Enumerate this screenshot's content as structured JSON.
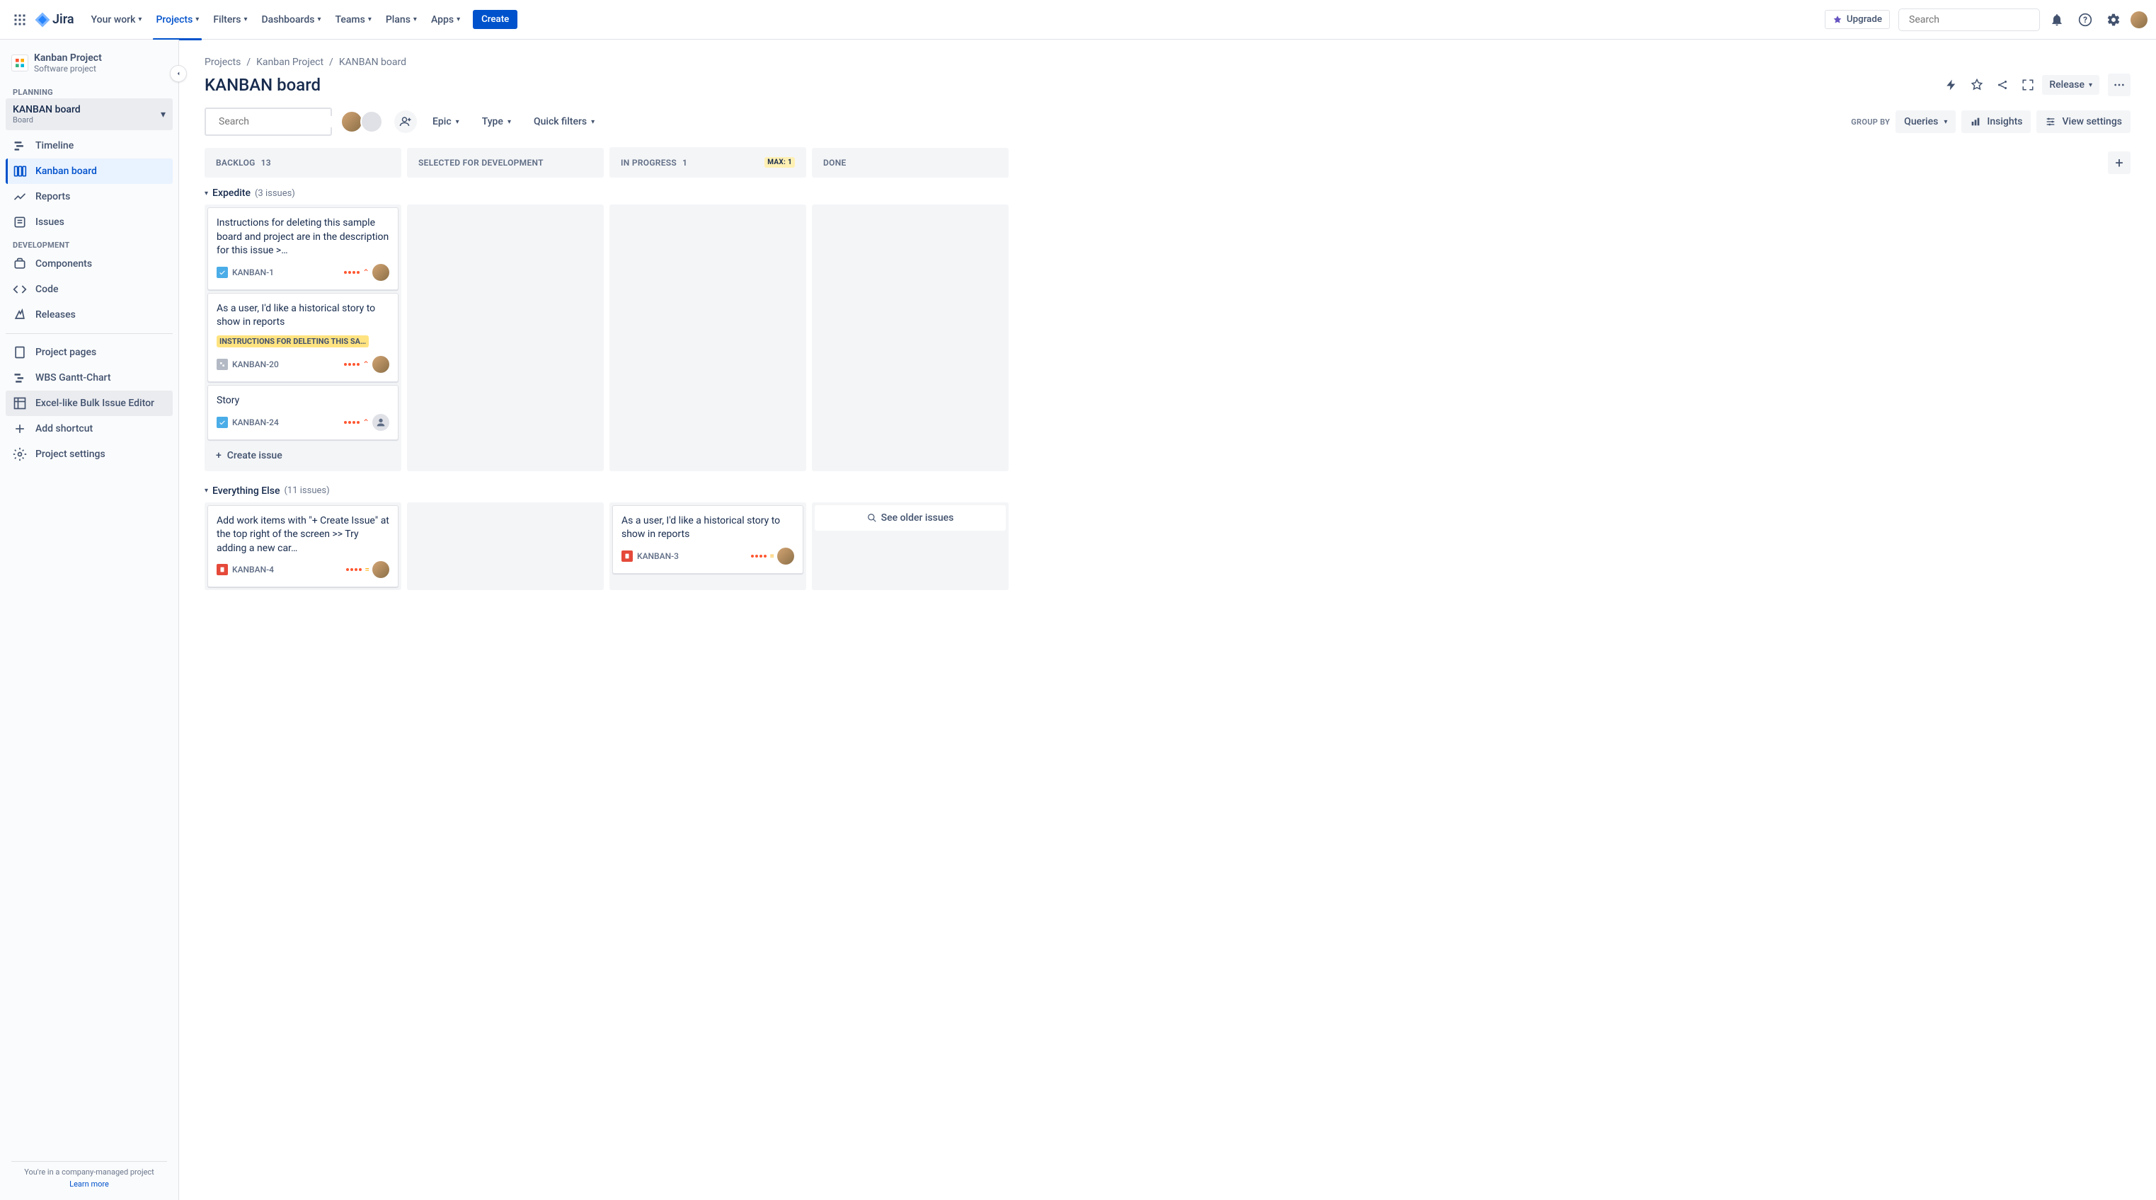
{
  "topnav": {
    "logo_text": "Jira",
    "items": [
      {
        "label": "Your work",
        "active": false
      },
      {
        "label": "Projects",
        "active": true
      },
      {
        "label": "Filters",
        "active": false
      },
      {
        "label": "Dashboards",
        "active": false
      },
      {
        "label": "Teams",
        "active": false
      },
      {
        "label": "Plans",
        "active": false
      },
      {
        "label": "Apps",
        "active": false
      }
    ],
    "create_label": "Create",
    "upgrade_label": "Upgrade",
    "search_placeholder": "Search"
  },
  "sidebar": {
    "project_name": "Kanban Project",
    "project_type": "Software project",
    "group_planning": "PLANNING",
    "board_selector": {
      "title": "KANBAN board",
      "subtitle": "Board"
    },
    "planning_items": [
      {
        "label": "Timeline",
        "selected": false
      },
      {
        "label": "Kanban board",
        "selected": true
      },
      {
        "label": "Reports",
        "selected": false
      },
      {
        "label": "Issues",
        "selected": false
      }
    ],
    "group_development": "DEVELOPMENT",
    "dev_items": [
      {
        "label": "Components"
      },
      {
        "label": "Code"
      },
      {
        "label": "Releases"
      }
    ],
    "other_items": [
      {
        "label": "Project pages"
      },
      {
        "label": "WBS Gantt-Chart"
      },
      {
        "label": "Excel-like Bulk Issue Editor"
      },
      {
        "label": "Add shortcut"
      },
      {
        "label": "Project settings"
      }
    ],
    "footer_text": "You're in a company-managed project",
    "learn_more": "Learn more"
  },
  "breadcrumbs": [
    "Projects",
    "Kanban Project",
    "KANBAN board"
  ],
  "page_title": "KANBAN board",
  "head_actions": {
    "release_label": "Release"
  },
  "controls": {
    "search_placeholder": "Search",
    "filter_epic": "Epic",
    "filter_type": "Type",
    "filter_quick": "Quick filters",
    "group_by_label": "GROUP BY",
    "queries_label": "Queries",
    "insights_label": "Insights",
    "view_settings_label": "View settings"
  },
  "columns": [
    {
      "name": "BACKLOG",
      "count": "13"
    },
    {
      "name": "SELECTED FOR DEVELOPMENT",
      "count": ""
    },
    {
      "name": "IN PROGRESS",
      "count": "1",
      "max": "MAX: 1"
    },
    {
      "name": "DONE",
      "count": ""
    }
  ],
  "swimlanes": [
    {
      "name": "Expedite",
      "issue_count": "(3 issues)",
      "lanes": [
        {
          "cards": [
            {
              "title": "Instructions for deleting this sample board and project are in the description for this issue >…",
              "type": "task",
              "key": "KANBAN-1",
              "priority": "highest",
              "assignee": "user"
            },
            {
              "title": "As a user, I'd like a historical story to show in reports",
              "epic": "INSTRUCTIONS FOR DELETING THIS SA…",
              "type": "subtask",
              "key": "KANBAN-20",
              "priority": "highest",
              "assignee": "user"
            },
            {
              "title": "Story",
              "type": "task",
              "key": "KANBAN-24",
              "priority": "highest",
              "assignee": "unassigned"
            }
          ],
          "create_label": "Create issue"
        },
        {
          "cards": []
        },
        {
          "cards": []
        },
        {
          "cards": []
        }
      ]
    },
    {
      "name": "Everything Else",
      "issue_count": "(11 issues)",
      "lanes": [
        {
          "cards": [
            {
              "title": "Add work items with \"+ Create Issue\" at the top right of the screen >> Try adding a new car…",
              "type": "story",
              "key": "KANBAN-4",
              "priority": "medium",
              "assignee": "user"
            }
          ]
        },
        {
          "cards": []
        },
        {
          "cards": [
            {
              "title": "As a user, I'd like a historical story to show in reports",
              "type": "story",
              "key": "KANBAN-3",
              "priority": "medium",
              "assignee": "user"
            }
          ]
        },
        {
          "see_older": "See older issues"
        }
      ]
    }
  ]
}
